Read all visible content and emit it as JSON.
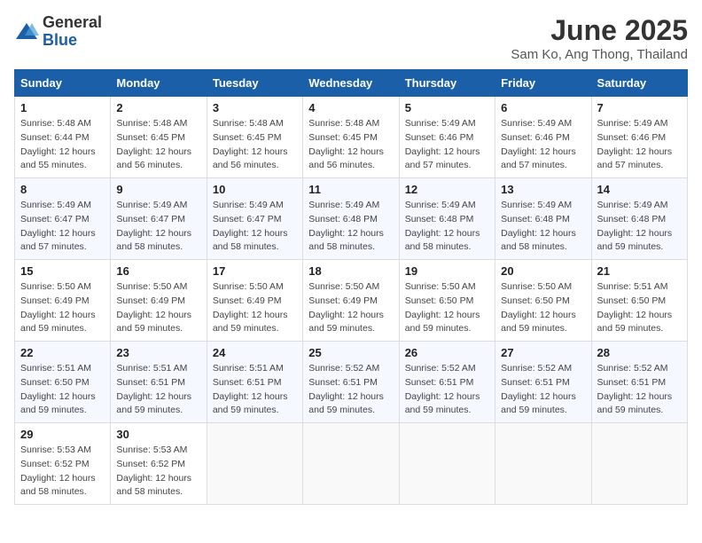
{
  "logo": {
    "general": "General",
    "blue": "Blue"
  },
  "title": "June 2025",
  "subtitle": "Sam Ko, Ang Thong, Thailand",
  "weekdays": [
    "Sunday",
    "Monday",
    "Tuesday",
    "Wednesday",
    "Thursday",
    "Friday",
    "Saturday"
  ],
  "weeks": [
    [
      {
        "day": 1,
        "sunrise": "5:48 AM",
        "sunset": "6:44 PM",
        "daylight": "12 hours and 55 minutes."
      },
      {
        "day": 2,
        "sunrise": "5:48 AM",
        "sunset": "6:45 PM",
        "daylight": "12 hours and 56 minutes."
      },
      {
        "day": 3,
        "sunrise": "5:48 AM",
        "sunset": "6:45 PM",
        "daylight": "12 hours and 56 minutes."
      },
      {
        "day": 4,
        "sunrise": "5:48 AM",
        "sunset": "6:45 PM",
        "daylight": "12 hours and 56 minutes."
      },
      {
        "day": 5,
        "sunrise": "5:49 AM",
        "sunset": "6:46 PM",
        "daylight": "12 hours and 57 minutes."
      },
      {
        "day": 6,
        "sunrise": "5:49 AM",
        "sunset": "6:46 PM",
        "daylight": "12 hours and 57 minutes."
      },
      {
        "day": 7,
        "sunrise": "5:49 AM",
        "sunset": "6:46 PM",
        "daylight": "12 hours and 57 minutes."
      }
    ],
    [
      {
        "day": 8,
        "sunrise": "5:49 AM",
        "sunset": "6:47 PM",
        "daylight": "12 hours and 57 minutes."
      },
      {
        "day": 9,
        "sunrise": "5:49 AM",
        "sunset": "6:47 PM",
        "daylight": "12 hours and 58 minutes."
      },
      {
        "day": 10,
        "sunrise": "5:49 AM",
        "sunset": "6:47 PM",
        "daylight": "12 hours and 58 minutes."
      },
      {
        "day": 11,
        "sunrise": "5:49 AM",
        "sunset": "6:48 PM",
        "daylight": "12 hours and 58 minutes."
      },
      {
        "day": 12,
        "sunrise": "5:49 AM",
        "sunset": "6:48 PM",
        "daylight": "12 hours and 58 minutes."
      },
      {
        "day": 13,
        "sunrise": "5:49 AM",
        "sunset": "6:48 PM",
        "daylight": "12 hours and 58 minutes."
      },
      {
        "day": 14,
        "sunrise": "5:49 AM",
        "sunset": "6:48 PM",
        "daylight": "12 hours and 59 minutes."
      }
    ],
    [
      {
        "day": 15,
        "sunrise": "5:50 AM",
        "sunset": "6:49 PM",
        "daylight": "12 hours and 59 minutes."
      },
      {
        "day": 16,
        "sunrise": "5:50 AM",
        "sunset": "6:49 PM",
        "daylight": "12 hours and 59 minutes."
      },
      {
        "day": 17,
        "sunrise": "5:50 AM",
        "sunset": "6:49 PM",
        "daylight": "12 hours and 59 minutes."
      },
      {
        "day": 18,
        "sunrise": "5:50 AM",
        "sunset": "6:49 PM",
        "daylight": "12 hours and 59 minutes."
      },
      {
        "day": 19,
        "sunrise": "5:50 AM",
        "sunset": "6:50 PM",
        "daylight": "12 hours and 59 minutes."
      },
      {
        "day": 20,
        "sunrise": "5:50 AM",
        "sunset": "6:50 PM",
        "daylight": "12 hours and 59 minutes."
      },
      {
        "day": 21,
        "sunrise": "5:51 AM",
        "sunset": "6:50 PM",
        "daylight": "12 hours and 59 minutes."
      }
    ],
    [
      {
        "day": 22,
        "sunrise": "5:51 AM",
        "sunset": "6:50 PM",
        "daylight": "12 hours and 59 minutes."
      },
      {
        "day": 23,
        "sunrise": "5:51 AM",
        "sunset": "6:51 PM",
        "daylight": "12 hours and 59 minutes."
      },
      {
        "day": 24,
        "sunrise": "5:51 AM",
        "sunset": "6:51 PM",
        "daylight": "12 hours and 59 minutes."
      },
      {
        "day": 25,
        "sunrise": "5:52 AM",
        "sunset": "6:51 PM",
        "daylight": "12 hours and 59 minutes."
      },
      {
        "day": 26,
        "sunrise": "5:52 AM",
        "sunset": "6:51 PM",
        "daylight": "12 hours and 59 minutes."
      },
      {
        "day": 27,
        "sunrise": "5:52 AM",
        "sunset": "6:51 PM",
        "daylight": "12 hours and 59 minutes."
      },
      {
        "day": 28,
        "sunrise": "5:52 AM",
        "sunset": "6:51 PM",
        "daylight": "12 hours and 59 minutes."
      }
    ],
    [
      {
        "day": 29,
        "sunrise": "5:53 AM",
        "sunset": "6:52 PM",
        "daylight": "12 hours and 58 minutes."
      },
      {
        "day": 30,
        "sunrise": "5:53 AM",
        "sunset": "6:52 PM",
        "daylight": "12 hours and 58 minutes."
      },
      null,
      null,
      null,
      null,
      null
    ]
  ]
}
